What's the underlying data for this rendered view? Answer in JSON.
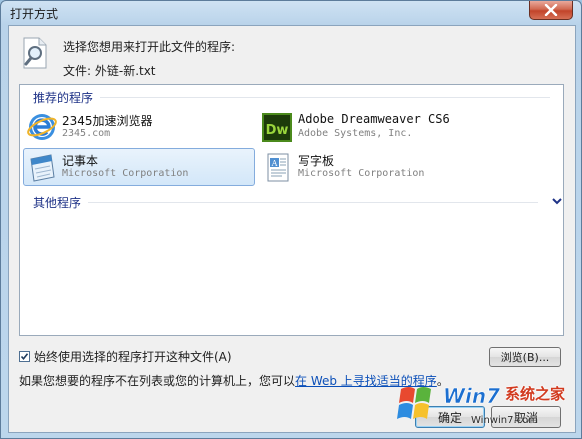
{
  "window": {
    "title": "打开方式"
  },
  "header": {
    "prompt": "选择您想用来打开此文件的程序:",
    "file_label": "文件:  外链-新.txt"
  },
  "recommended": {
    "heading": "推荐的程序",
    "programs": [
      {
        "name": "2345加速浏览器",
        "vendor": "2345.com",
        "icon": "browser-e-icon",
        "selected": false
      },
      {
        "name": "Adobe Dreamweaver CS6",
        "vendor": "Adobe Systems, Inc.",
        "icon": "dreamweaver-icon",
        "icon_text": "Dw",
        "selected": false
      },
      {
        "name": "记事本",
        "vendor": "Microsoft Corporation",
        "icon": "notepad-icon",
        "selected": true
      },
      {
        "name": "写字板",
        "vendor": "Microsoft Corporation",
        "icon": "wordpad-icon",
        "selected": false
      }
    ]
  },
  "other": {
    "heading": "其他程序"
  },
  "always_use": {
    "label": "始终使用选择的程序打开这种文件(A)",
    "checked": true
  },
  "browse_label": "浏览(B)...",
  "help": {
    "prefix": "如果您想要的程序不在列表或您的计算机上，您可以",
    "link": "在 Web 上寻找适当的程序",
    "suffix": "。"
  },
  "buttons": {
    "ok": "确定",
    "cancel": "取消"
  },
  "watermark": {
    "brand": "系统之家",
    "logo_text": "Win7",
    "site": "Winwin7.com"
  },
  "colors": {
    "link": "#0b4fb8",
    "group_heading": "#1e3287",
    "selection": "#d3e7f9",
    "dw_green": "#4b8a1c"
  }
}
